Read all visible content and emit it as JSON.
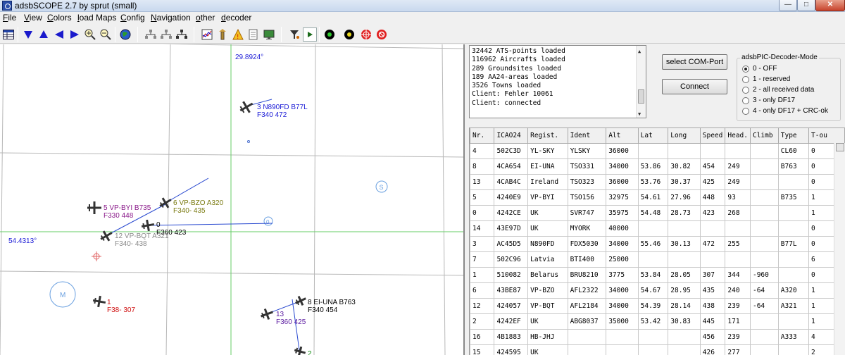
{
  "window": {
    "title": "adsbSCOPE 2.7 by sprut  (small)"
  },
  "menu": [
    {
      "underline": "F",
      "rest": "ile"
    },
    {
      "underline": "V",
      "rest": "iew"
    },
    {
      "underline": "C",
      "rest": "olors"
    },
    {
      "underline": "l",
      "rest": "oad Maps"
    },
    {
      "underline": "C",
      "rest": "onfig"
    },
    {
      "underline": "N",
      "rest": "avigation"
    },
    {
      "underline": "o",
      "rest": "ther"
    },
    {
      "underline": "d",
      "rest": "ecoder"
    }
  ],
  "toolbar_icons": [
    "table-icon",
    "down-arrow-icon",
    "up-arrow-icon",
    "left-arrow-icon",
    "right-arrow-icon",
    "zoom-in-icon",
    "zoom-out-icon",
    "globe-icon",
    "tree-icon",
    "tree2-icon",
    "tree3-icon",
    "chart-icon",
    "tower-icon",
    "warning-icon",
    "document-icon",
    "monitor-icon",
    "filter-icon",
    "play-icon",
    "dot-icon",
    "dot2-icon",
    "target-icon",
    "record-icon"
  ],
  "map": {
    "lon_label": "29.8924°",
    "lat_label": "54.4313°",
    "aircraft": [
      {
        "line1": "3  N890FD  B77L",
        "line2": "F340   472",
        "color": "#1a1ad6"
      },
      {
        "line1": "5  VP-BYI  B735",
        "line2": "F330   448",
        "color": "#8a1a8a"
      },
      {
        "line1": "6  VP-BZO  A320",
        "line2": "F340-  435",
        "color": "#7a7a10"
      },
      {
        "line1": "0",
        "line2": "F360   423",
        "color": "#000000"
      },
      {
        "line1": "12  VP-BQT  A321",
        "line2": "F340-  438",
        "color": "#8a8a8a"
      },
      {
        "line1": "1",
        "line2": "F38-  307",
        "color": "#d01010"
      },
      {
        "line1": "8  EI-UNA  B763",
        "line2": "F340   454",
        "color": "#000000"
      },
      {
        "line1": "13",
        "line2": "F360   425",
        "color": "#5a1aa0"
      },
      {
        "line1": "2",
        "line2": "",
        "color": "#0a8a0a"
      }
    ],
    "markers": {
      "s": "S",
      "zero": "0",
      "m": "M"
    }
  },
  "log": [
    "32442 ATS-points loaded",
    "116962 Aircrafts loaded",
    "289 Groundsites loaded",
    "189 AA24-areas loaded",
    "3526 Towns loaded",
    "Client: Fehler 10061",
    "Client: connected"
  ],
  "buttons": {
    "com": "select COM-Port",
    "connect": "Connect"
  },
  "decoder": {
    "title": "adsbPIC-Decoder-Mode",
    "options": [
      "0 - OFF",
      "1 - reserved",
      "2 - all received data",
      "3 - only DF17",
      "4 - only DF17 + CRC-ok"
    ],
    "selected": 0
  },
  "table": {
    "headers": [
      "Nr.",
      "ICAO24",
      "Regist.",
      "Ident",
      "Alt",
      "Lat",
      "Long",
      "Speed",
      "Head.",
      "Climb",
      "Type",
      "T-ou"
    ],
    "rows": [
      [
        "4",
        "502C3D",
        "YL-SKY",
        "YLSKY",
        "36000",
        "",
        "",
        "",
        "",
        "",
        "CL60",
        "0"
      ],
      [
        "8",
        "4CA654",
        "EI-UNA",
        "TSO331",
        "34000",
        "53.86",
        "30.82",
        "454",
        "249",
        "",
        "B763",
        "0"
      ],
      [
        "13",
        "4CAB4C",
        "Ireland",
        "TSO323",
        "36000",
        "53.76",
        "30.37",
        "425",
        "249",
        "",
        "",
        "0"
      ],
      [
        "5",
        "4240E9",
        "VP-BYI",
        "TSO156",
        "32975",
        "54.61",
        "27.96",
        "448",
        "93",
        "",
        "B735",
        "1"
      ],
      [
        "0",
        "4242CE",
        "UK",
        "SVR747",
        "35975",
        "54.48",
        "28.73",
        "423",
        "268",
        "",
        "",
        "1"
      ],
      [
        "14",
        "43E97D",
        "UK",
        "MYORK",
        "40000",
        "",
        "",
        "",
        "",
        "",
        "",
        "0"
      ],
      [
        "3",
        "AC45D5",
        "N890FD",
        "FDX5030",
        "34000",
        "55.46",
        "30.13",
        "472",
        "255",
        "",
        "B77L",
        "0"
      ],
      [
        "7",
        "502C96",
        "Latvia",
        "BTI400",
        "25000",
        "",
        "",
        "",
        "",
        "",
        "",
        "6"
      ],
      [
        "1",
        "510082",
        "Belarus",
        "BRU8210",
        "3775",
        "53.84",
        "28.05",
        "307",
        "344",
        "-960",
        "",
        "0"
      ],
      [
        "6",
        "43BE87",
        "VP-BZO",
        "AFL2322",
        "34000",
        "54.67",
        "28.95",
        "435",
        "240",
        "-64",
        "A320",
        "1"
      ],
      [
        "12",
        "424057",
        "VP-BQT",
        "AFL2184",
        "34000",
        "54.39",
        "28.14",
        "438",
        "239",
        "-64",
        "A321",
        "1"
      ],
      [
        "2",
        "4242EF",
        "UK",
        "ABG8037",
        "35000",
        "53.42",
        "30.83",
        "445",
        "171",
        "",
        "",
        "1"
      ],
      [
        "16",
        "4B1883",
        "HB-JHJ",
        "",
        "",
        "",
        "",
        "456",
        "239",
        "",
        "A333",
        "4"
      ],
      [
        "15",
        "424595",
        "UK",
        "",
        "",
        "",
        "",
        "426",
        "277",
        "",
        "",
        "2"
      ]
    ]
  }
}
